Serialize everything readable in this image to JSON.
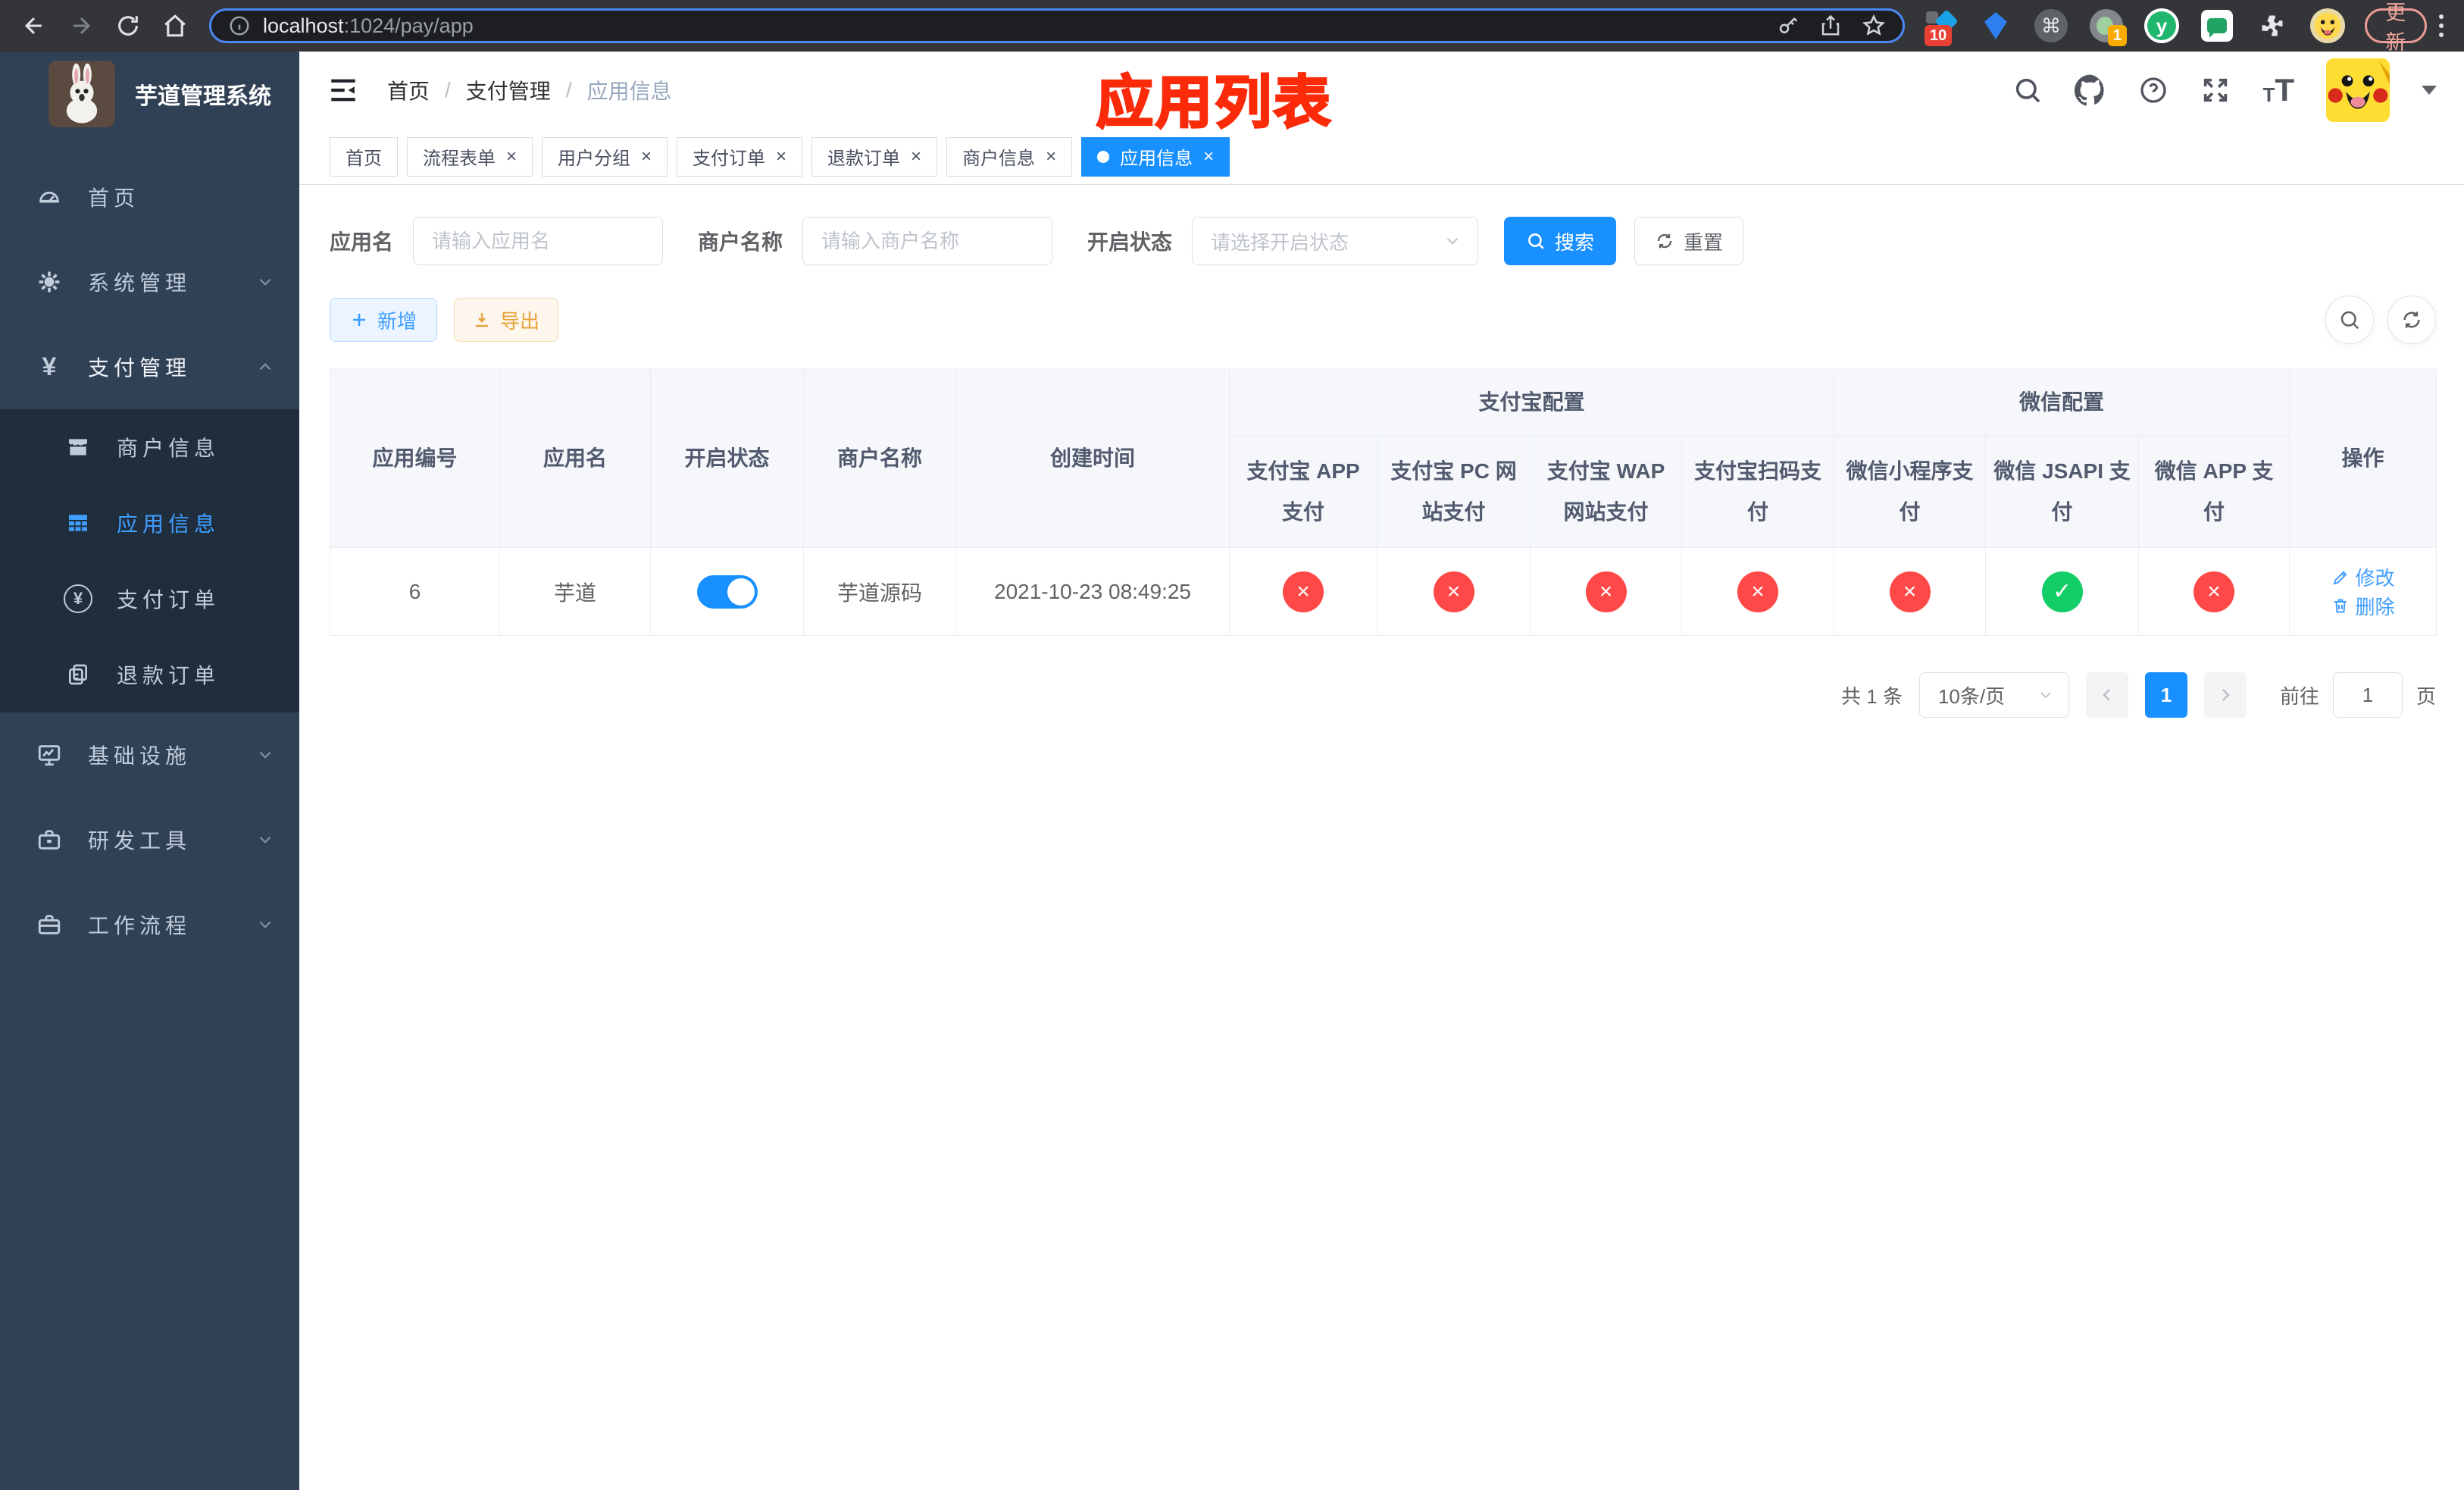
{
  "browser": {
    "url_host": "localhost",
    "url_path": ":1024/pay/app",
    "update_button": "更新",
    "ext_badge_a": "10",
    "ext_badge_b": "1"
  },
  "glyphs": {
    "command": "⌘",
    "question": "?",
    "font_small": "T",
    "font_large": "T",
    "yen": "¥",
    "ext_y": "y"
  },
  "sidebar": {
    "title": "芋道管理系统",
    "menu": [
      {
        "label": "首页",
        "icon": "dashboard-icon"
      },
      {
        "label": "系统管理",
        "icon": "gear-icon",
        "expanded": false
      },
      {
        "label": "支付管理",
        "icon": "yen-icon",
        "expanded": true,
        "children": [
          {
            "label": "商户信息",
            "icon": "store-icon",
            "active": false
          },
          {
            "label": "应用信息",
            "icon": "grid-icon",
            "active": true
          },
          {
            "label": "支付订单",
            "icon": "yen-circle-icon",
            "active": false
          },
          {
            "label": "退款订单",
            "icon": "document-icon",
            "active": false
          }
        ]
      },
      {
        "label": "基础设施",
        "icon": "monitor-icon",
        "expanded": false
      },
      {
        "label": "研发工具",
        "icon": "toolbox-icon",
        "expanded": false
      },
      {
        "label": "工作流程",
        "icon": "briefcase-icon",
        "expanded": false
      }
    ]
  },
  "header": {
    "breadcrumb": [
      "首页",
      "支付管理",
      "应用信息"
    ],
    "annotation": "应用列表"
  },
  "tabs": [
    {
      "label": "首页",
      "closable": false,
      "active": false
    },
    {
      "label": "流程表单",
      "closable": true,
      "active": false
    },
    {
      "label": "用户分组",
      "closable": true,
      "active": false
    },
    {
      "label": "支付订单",
      "closable": true,
      "active": false
    },
    {
      "label": "退款订单",
      "closable": true,
      "active": false
    },
    {
      "label": "商户信息",
      "closable": true,
      "active": false
    },
    {
      "label": "应用信息",
      "closable": true,
      "active": true
    }
  ],
  "filters": {
    "app_name_label": "应用名",
    "app_name_placeholder": "请输入应用名",
    "merchant_label": "商户名称",
    "merchant_placeholder": "请输入商户名称",
    "status_label": "开启状态",
    "status_placeholder": "请选择开启状态",
    "search_button": "搜索",
    "reset_button": "重置"
  },
  "toolbar": {
    "add_button": "新增",
    "export_button": "导出"
  },
  "table": {
    "headers": {
      "app_id": "应用编号",
      "app_name": "应用名",
      "enabled": "开启状态",
      "merchant": "商户名称",
      "created": "创建时间",
      "alipay_group": "支付宝配置",
      "alipay_cols": [
        "支付宝 APP 支付",
        "支付宝 PC 网站支付",
        "支付宝 WAP 网站支付",
        "支付宝扫码支付"
      ],
      "wechat_group": "微信配置",
      "wechat_cols": [
        "微信小程序支付",
        "微信 JSAPI 支付",
        "微信 APP 支付"
      ],
      "actions": "操作"
    },
    "row": {
      "app_id": "6",
      "app_name": "芋道",
      "enabled": true,
      "merchant": "芋道源码",
      "created": "2021-10-23 08:49:25",
      "statuses": [
        {
          "enabled": false,
          "glyph": "×"
        },
        {
          "enabled": false,
          "glyph": "×"
        },
        {
          "enabled": false,
          "glyph": "×"
        },
        {
          "enabled": false,
          "glyph": "×"
        },
        {
          "enabled": false,
          "glyph": "×"
        },
        {
          "enabled": true,
          "glyph": "✓"
        },
        {
          "enabled": false,
          "glyph": "×"
        }
      ],
      "edit_label": "修改",
      "delete_label": "删除"
    }
  },
  "pagination": {
    "total": "共 1 条",
    "page_size": "10条/页",
    "current_page": "1",
    "goto_label": "前往",
    "goto_value": "1",
    "page_unit": "页"
  },
  "colors": {
    "accent": "#1890ff",
    "link": "#409eff",
    "success": "#13ce66",
    "danger": "#ff4949",
    "warning": "#e6a23c",
    "sidebar_bg": "#304156",
    "submenu_bg": "#1f2d3d"
  }
}
